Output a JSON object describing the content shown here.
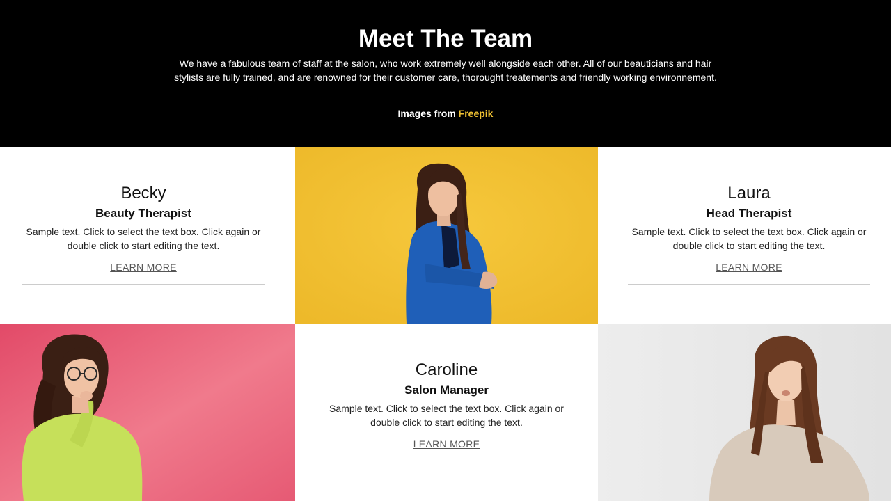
{
  "header": {
    "title": "Meet The Team",
    "description": "We have a fabulous team of staff at the salon, who work extremely well alongside each other. All of our beauticians and hair stylists are fully trained, and are renowned for their customer care, thorought treatements and friendly working environnement.",
    "credit_prefix": "Images from ",
    "credit_link": "Freepik"
  },
  "team": [
    {
      "name": "Becky",
      "role": "Beauty Therapist",
      "text": "Sample text. Click to select the text box. Click again or double click to start editing the text.",
      "link": "LEARN MORE"
    },
    {
      "name": "Laura",
      "role": "Head Therapist",
      "text": "Sample text. Click to select the text box. Click again or double click to start editing the text.",
      "link": "LEARN MORE"
    },
    {
      "name": "Caroline",
      "role": "Salon Manager",
      "text": "Sample text. Click to select the text box. Click again or double click to start editing the text.",
      "link": "LEARN MORE"
    }
  ],
  "colors": {
    "header_bg": "#000000",
    "credit_link": "#f1c232",
    "photo_yellow_bg": "#f2c230",
    "photo_pink_bg": "#e8607a",
    "photo_grey_bg": "#e9e9e9"
  }
}
